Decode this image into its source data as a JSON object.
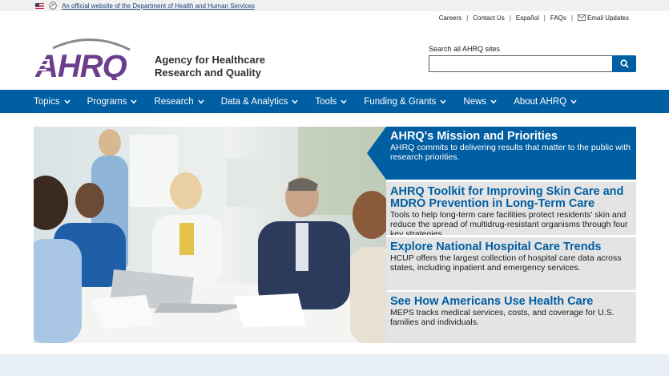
{
  "gov_banner": {
    "link_text": "An official website of the Department of Health and Human Services"
  },
  "utility": {
    "links": [
      "Careers",
      "Contact Us",
      "Español",
      "FAQs"
    ],
    "email_label": "Email Updates"
  },
  "logo": {
    "text": "AHRQ"
  },
  "agency": {
    "line1": "Agency for Healthcare",
    "line2": "Research and Quality"
  },
  "search": {
    "label": "Search all AHRQ sites",
    "placeholder": ""
  },
  "nav": {
    "items": [
      "Topics",
      "Programs",
      "Research",
      "Data & Analytics",
      "Tools",
      "Funding & Grants",
      "News",
      "About AHRQ"
    ]
  },
  "hero": {
    "panels": [
      {
        "title": "AHRQ's Mission and Priorities",
        "text": "AHRQ commits to delivering results that matter to the public with research priorities."
      },
      {
        "title": "AHRQ Toolkit for Improving Skin Care and MDRO Prevention in Long-Term Care",
        "text": "Tools to help long-term care facilities protect residents' skin and reduce the spread of multidrug-resistant organisms through four key strategies."
      },
      {
        "title": "Explore National Hospital Care Trends",
        "text": "HCUP offers the largest collection of hospital care data across states, including inpatient and emergency services."
      },
      {
        "title": "See How Americans Use Health Care",
        "text": "MEPS tracks medical services, costs, and coverage for U.S. families and individuals."
      }
    ]
  },
  "colors": {
    "primary": "#005ea2",
    "logo_purple": "#6b3f8c",
    "panel_bg": "#e4e4e4"
  }
}
